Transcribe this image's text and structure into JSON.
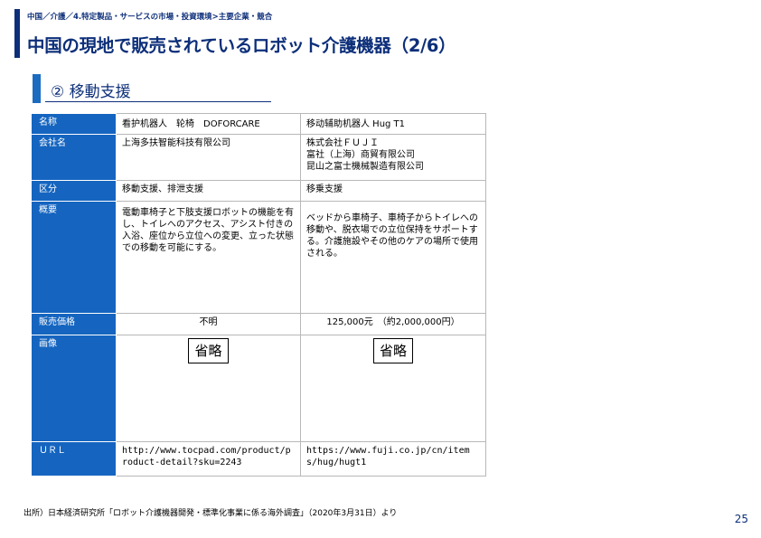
{
  "header": {
    "breadcrumb": "中国／介護／4.特定製品・サービスの市場・投資環境>主要企業・競合",
    "title": "中国の現地で販売されているロボット介護機器（2/6）"
  },
  "section": {
    "title": "② 移動支援"
  },
  "table": {
    "rows": [
      {
        "label": "名称",
        "col1": "看护机器人　轮椅　DOFORCARE",
        "col2": "移动辅助机器人 Hug T1"
      },
      {
        "label": "会社名",
        "col1": "上海多扶智能科技有限公司",
        "col2_lines": [
          "株式会社ＦＵＪＩ",
          "富社（上海）商貿有限公司",
          "昆山之富士機械製造有限公司"
        ]
      },
      {
        "label": "区分",
        "col1": "移動支援、排泄支援",
        "col2": "移乗支援"
      },
      {
        "label": "概要",
        "col1": "電動車椅子と下肢支援ロボットの機能を有し、トイレへのアクセス、アシスト付きの入浴、座位から立位への変更、立った状態での移動を可能にする。",
        "col2": "ベッドから車椅子、車椅子からトイレへの移動や、脱衣場での立位保持をサポートする。介護施設やその他のケアの場所で使用される。"
      },
      {
        "label": "販売価格",
        "col1": "不明",
        "col2": "125,000元　（約2,000,000円）"
      },
      {
        "label": "画像",
        "col1": "省略",
        "col2": "省略"
      },
      {
        "label": "ＵＲＬ",
        "col1": "http://www.tocpad.com/product/product-detail?sku=2243",
        "col2": "https://www.fuji.co.jp/cn/items/hug/hugt1"
      }
    ]
  },
  "footer": {
    "source": "出所）日本経済研究所「ロボット介護機器開発・標準化事業に係る海外調査」（2020年3月31日）より",
    "page_number": "25"
  }
}
